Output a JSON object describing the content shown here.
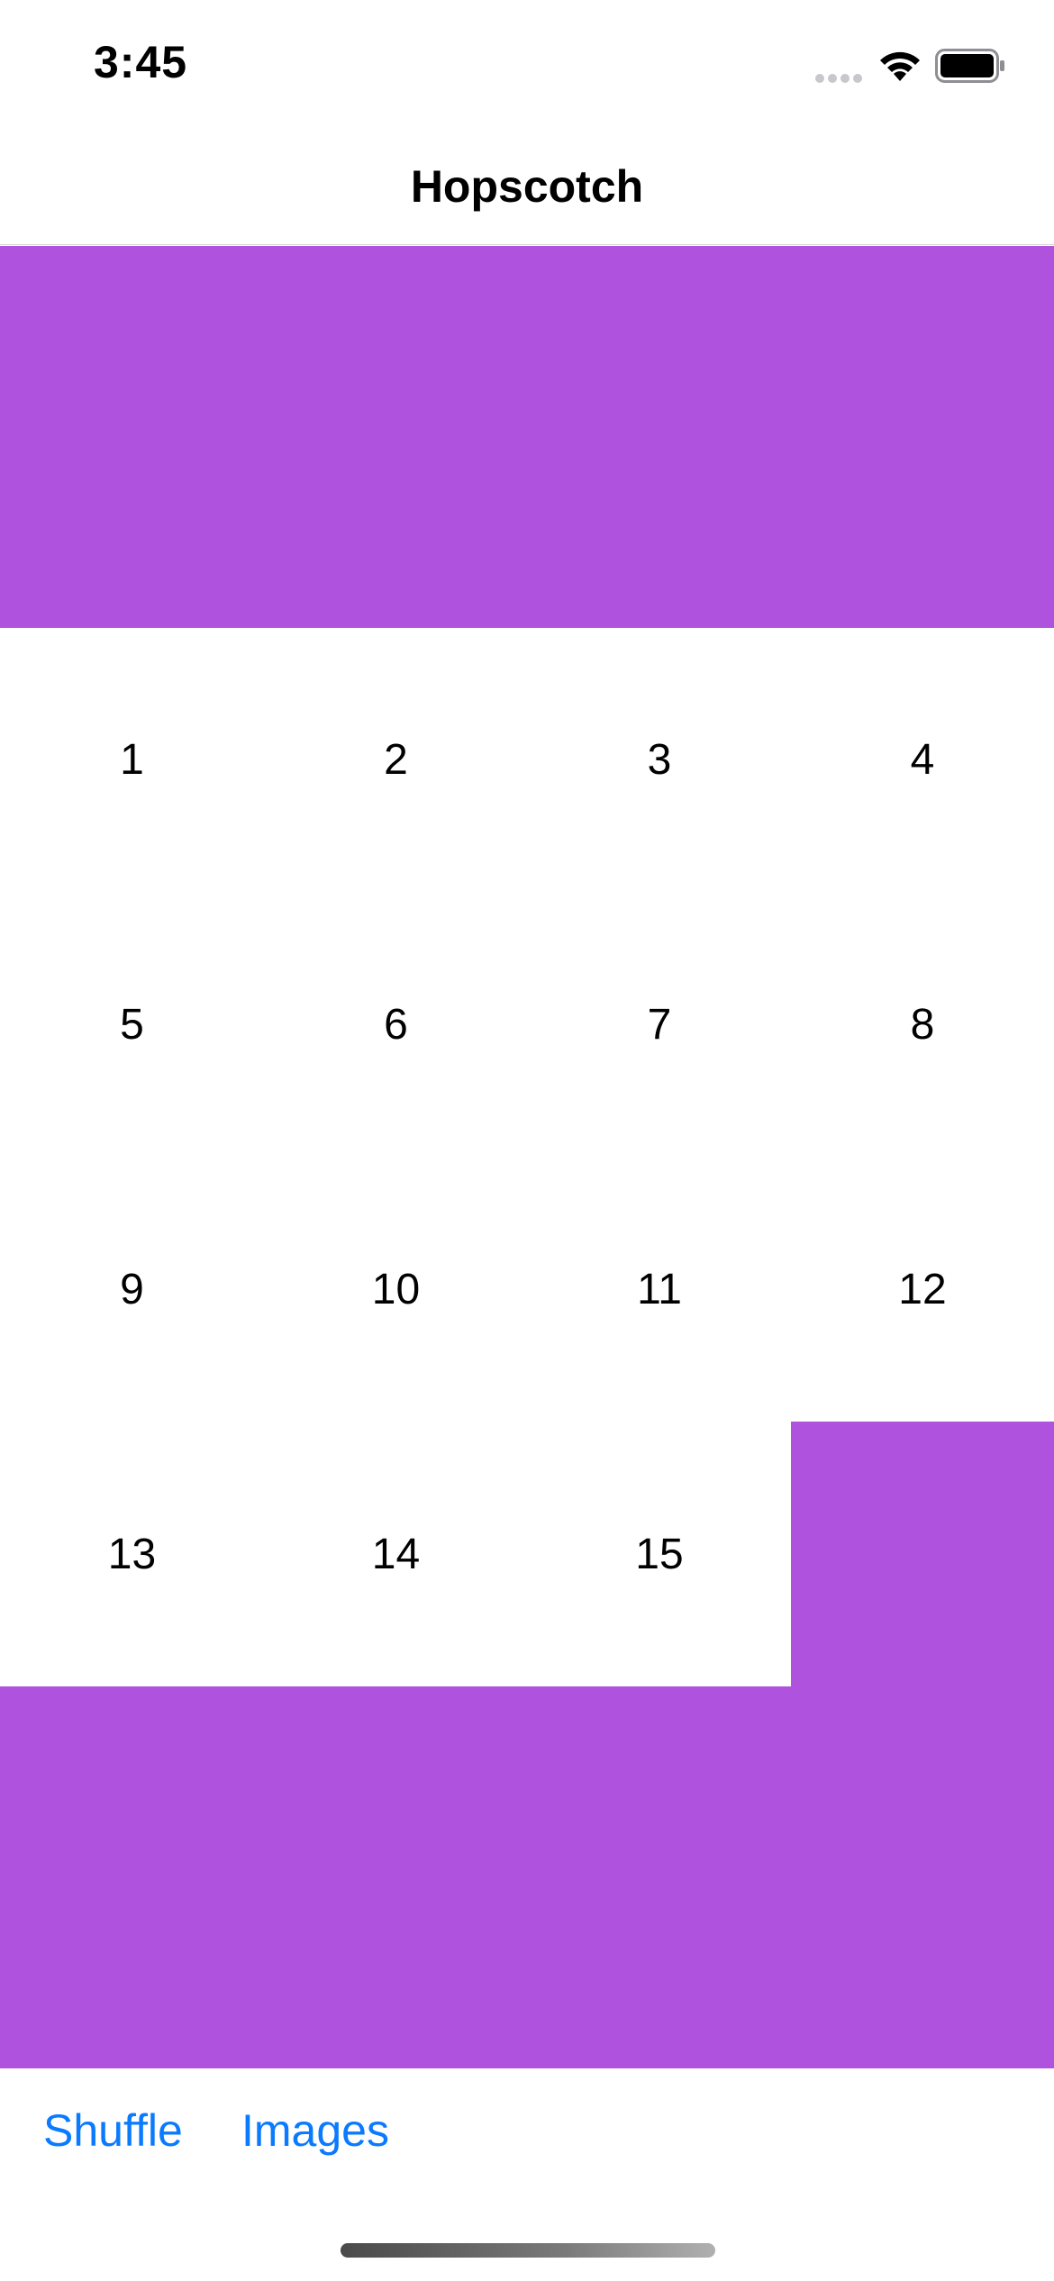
{
  "status_bar": {
    "time": "3:45",
    "icons": [
      "signal-icon",
      "wifi-icon",
      "battery-icon"
    ]
  },
  "nav": {
    "title": "Hopscotch"
  },
  "board": {
    "accent_color": "#af52de",
    "tiles": [
      "1",
      "2",
      "3",
      "4",
      "5",
      "6",
      "7",
      "8",
      "9",
      "10",
      "11",
      "12",
      "13",
      "14",
      "15",
      ""
    ]
  },
  "toolbar": {
    "shuffle_label": "Shuffle",
    "images_label": "Images",
    "button_color": "#0a7aff"
  }
}
